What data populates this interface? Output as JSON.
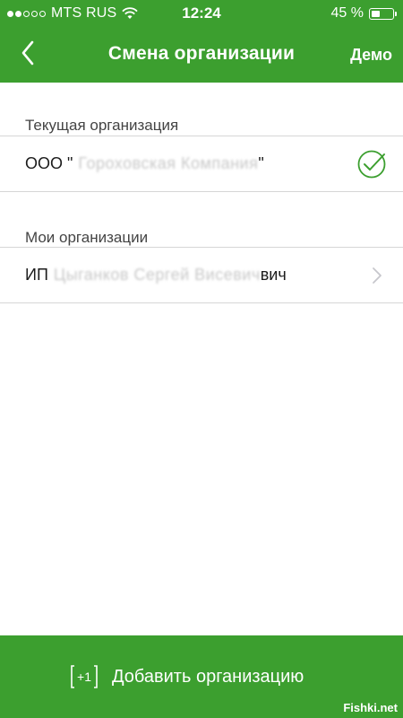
{
  "status_bar": {
    "carrier": "MTS RUS",
    "time": "12:24",
    "battery_percent": "45 %",
    "battery_level": 0.45,
    "signal_bars_filled": 2,
    "signal_bars_total": 5
  },
  "nav": {
    "title": "Смена организации",
    "right_action": "Демо",
    "back_icon": "chevron-left-icon"
  },
  "current_section": {
    "header": "Текущая организация",
    "org_prefix": "ООО \"",
    "org_name_redacted": "Гороховская Компания",
    "org_suffix": "\"",
    "selected_icon": "check-circle-icon"
  },
  "my_section": {
    "header": "Мои организации",
    "org_prefix": "ИП",
    "org_name_redacted": "Цыганков Сергей Висевич",
    "org_tail": "вич",
    "row_icon": "chevron-right-icon"
  },
  "bottom_action": {
    "label": "Добавить организацию",
    "icon": "add-organization-icon",
    "icon_text": "+1"
  },
  "watermark": "Fishki.net",
  "colors": {
    "accent": "#3c9f2f",
    "divider": "#d6d6d6",
    "check": "#3c9f2f",
    "chevron": "#c7c7cc"
  }
}
